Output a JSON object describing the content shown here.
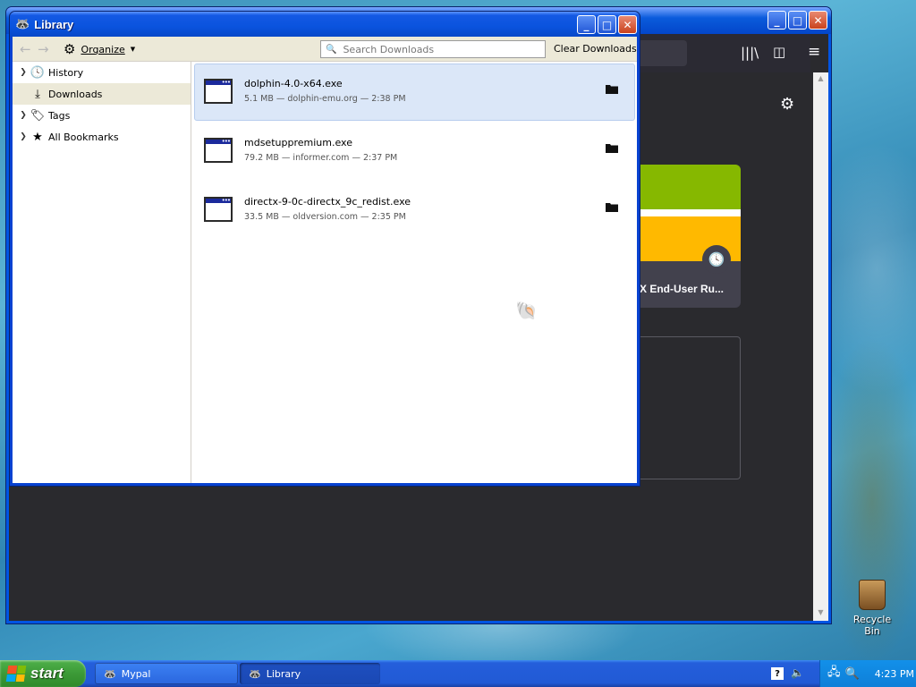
{
  "background_window": {
    "card_label": "X End-User Ru..."
  },
  "library": {
    "title": "Library",
    "toolbar": {
      "organize_label": "Organize",
      "search_placeholder": "Search Downloads",
      "clear_label": "Clear Downloads"
    },
    "sidebar": [
      {
        "label": "History",
        "icon": "clock-icon"
      },
      {
        "label": "Downloads",
        "icon": "download-icon"
      },
      {
        "label": "Tags",
        "icon": "tag-icon"
      },
      {
        "label": "All Bookmarks",
        "icon": "star-icon"
      }
    ],
    "downloads": [
      {
        "name": "dolphin-4.0-x64.exe",
        "meta": "5.1 MB — dolphin-emu.org — 2:38 PM"
      },
      {
        "name": "mdsetuppremium.exe",
        "meta": "79.2 MB — informer.com — 2:37 PM"
      },
      {
        "name": "directx-9-0c-directx_9c_redist.exe",
        "meta": "33.5 MB — oldversion.com — 2:35 PM"
      }
    ]
  },
  "desktop": {
    "recycle_bin_label": "Recycle Bin"
  },
  "taskbar": {
    "start_label": "start",
    "tasks": [
      {
        "label": "Mypal"
      },
      {
        "label": "Library"
      }
    ],
    "clock": "4:23 PM"
  },
  "colors": {
    "xp_blue": "#0054e3",
    "selection": "#dbe7f8",
    "start_green": "#3c9a37"
  }
}
